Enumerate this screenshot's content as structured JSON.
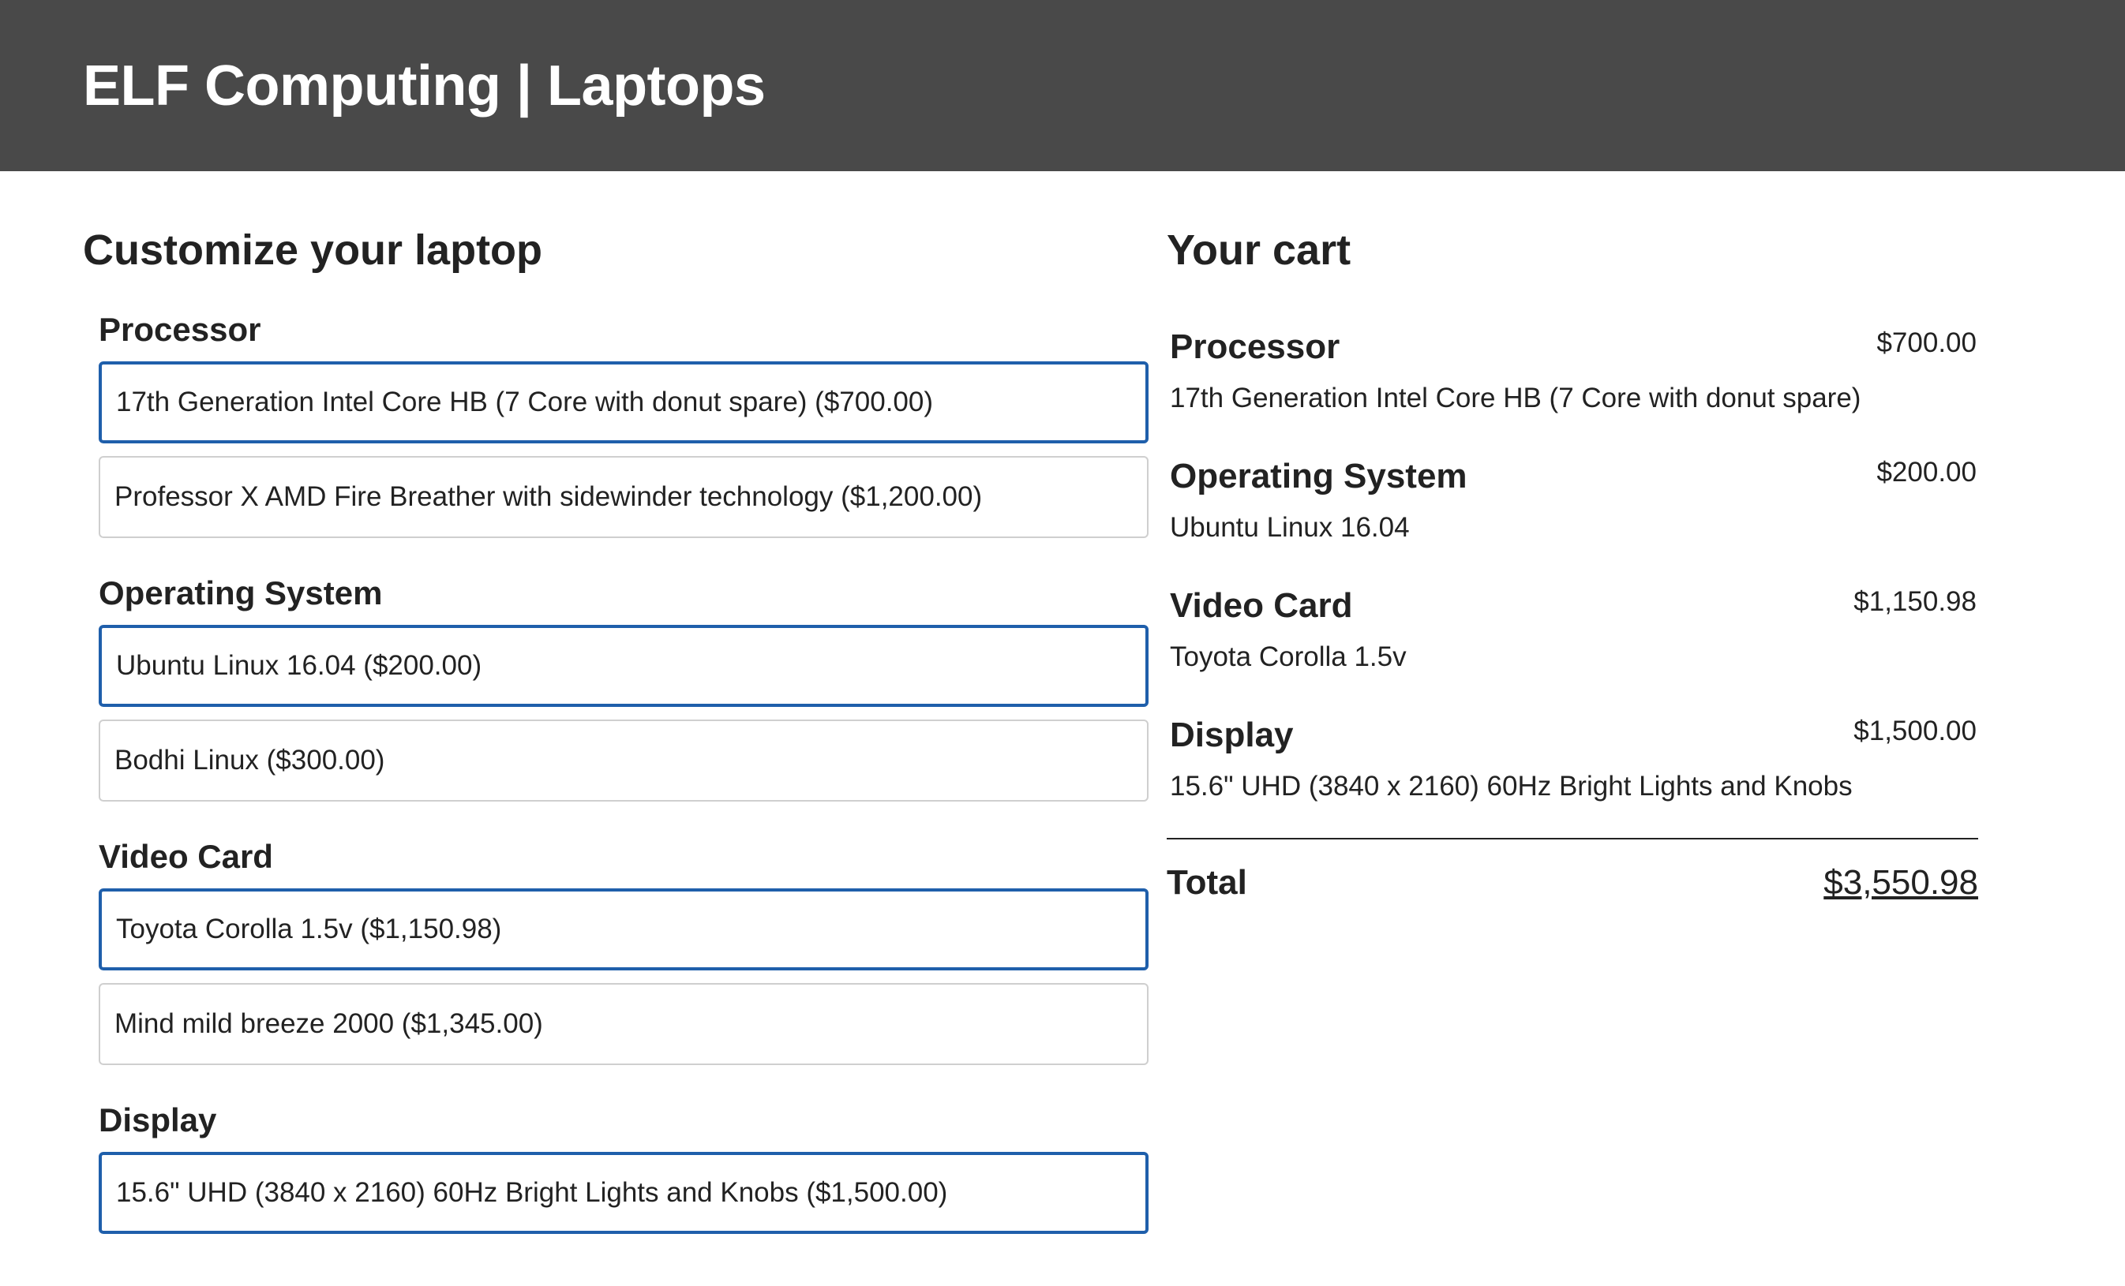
{
  "header": {
    "title": "ELF Computing | Laptops"
  },
  "customize": {
    "title": "Customize your laptop",
    "features": [
      {
        "name": "Processor",
        "options": [
          {
            "label": "17th Generation Intel Core HB (7 Core with donut spare) ($700.00)",
            "selected": true
          },
          {
            "label": "Professor X AMD Fire Breather with sidewinder technology ($1,200.00)",
            "selected": false
          }
        ]
      },
      {
        "name": "Operating System",
        "options": [
          {
            "label": "Ubuntu Linux 16.04 ($200.00)",
            "selected": true
          },
          {
            "label": "Bodhi Linux ($300.00)",
            "selected": false
          }
        ]
      },
      {
        "name": "Video Card",
        "options": [
          {
            "label": "Toyota Corolla 1.5v ($1,150.98)",
            "selected": true
          },
          {
            "label": "Mind mild breeze 2000 ($1,345.00)",
            "selected": false
          }
        ]
      },
      {
        "name": "Display",
        "options": [
          {
            "label": "15.6\" UHD (3840 x 2160) 60Hz Bright Lights and Knobs ($1,500.00)",
            "selected": true
          }
        ]
      }
    ]
  },
  "cart": {
    "title": "Your cart",
    "items": [
      {
        "feature": "Processor",
        "option": "17th Generation Intel Core HB (7 Core with donut spare)",
        "price": "$700.00"
      },
      {
        "feature": "Operating System",
        "option": "Ubuntu Linux 16.04",
        "price": "$200.00"
      },
      {
        "feature": "Video Card",
        "option": "Toyota Corolla 1.5v",
        "price": "$1,150.98"
      },
      {
        "feature": "Display",
        "option": "15.6\" UHD (3840 x 2160) 60Hz Bright Lights and Knobs",
        "price": "$1,500.00"
      }
    ],
    "total_label": "Total",
    "total_value": "$3,550.98"
  },
  "colors": {
    "header_bg": "#494949",
    "selected_border": "#1f5fab",
    "option_border": "#cfcfcf"
  }
}
